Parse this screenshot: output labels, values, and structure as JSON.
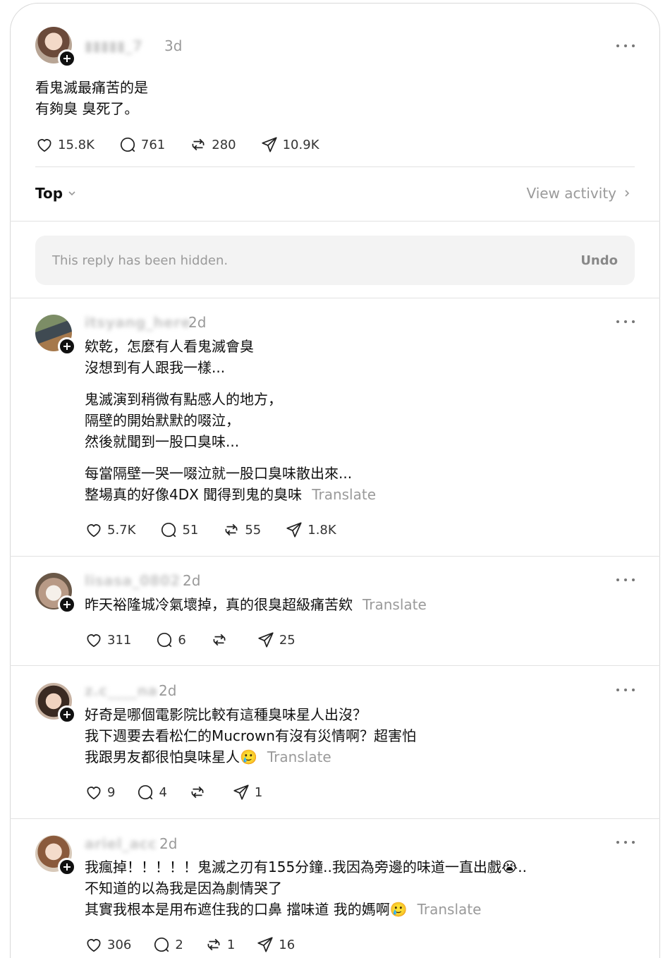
{
  "original_post": {
    "username": "▮▮▮▮▮_7",
    "time": "3d",
    "text": "看鬼滅最痛苦的是\n有夠臭 臭死了。",
    "likes": "15.8K",
    "replies": "761",
    "reposts": "280",
    "shares": "10.9K"
  },
  "sort": {
    "label": "Top",
    "view_activity": "View activity"
  },
  "hidden_reply": {
    "text": "This reply has been hidden.",
    "undo": "Undo"
  },
  "replies": [
    {
      "username": "itsyang_here",
      "time": "2d",
      "text": "欸乾，怎麼有人看鬼滅會臭\n沒想到有人跟我一樣...",
      "text2": "鬼滅演到稍微有點感人的地方，\n隔壁的開始默默的啜泣，\n然後就聞到一股口臭味...",
      "text3": "每當隔壁一哭一啜泣就一股口臭味散出來...\n整場真的好像4DX 聞得到鬼的臭味",
      "translate": "Translate",
      "likes": "5.7K",
      "replies": "51",
      "reposts": "55",
      "shares": "1.8K"
    },
    {
      "username": "lisasa_0802",
      "time": "2d",
      "text": "昨天裕隆城冷氣壞掉，真的很臭超級痛苦欸",
      "translate": "Translate",
      "likes": "311",
      "replies": "6",
      "reposts": "",
      "shares": "25"
    },
    {
      "username": "z.c____na",
      "time": "2d",
      "text": "好奇是哪個電影院比較有這種臭味星人出沒？\n我下週要去看松仁的Mucrown有沒有災情啊？超害怕\n我跟男友都很怕臭味星人🥲",
      "translate": "Translate",
      "likes": "9",
      "replies": "4",
      "reposts": "",
      "shares": "1"
    },
    {
      "username": "ariel_acc",
      "time": "2d",
      "text": "我瘋掉！！！！！鬼滅之刃有155分鐘..我因為旁邊的味道一直出戲😭..\n不知道的以為我是因為劇情哭了\n其實我根本是用布遮住我的口鼻 擋味道 我的媽啊🥲",
      "translate": "Translate",
      "likes": "306",
      "replies": "2",
      "reposts": "1",
      "shares": "16"
    }
  ],
  "icons": [
    "heart-icon",
    "comment-icon",
    "repost-icon",
    "share-icon",
    "more-icon",
    "follow-plus-icon",
    "chevron-down-icon",
    "chevron-right-icon"
  ]
}
